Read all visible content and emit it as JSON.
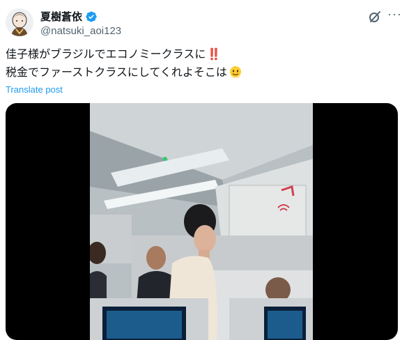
{
  "user": {
    "display_name": "夏樹蒼依",
    "handle": "@natsuki_aoi123",
    "verified": true,
    "verified_color": "#1d9bf0"
  },
  "post": {
    "line1": "佳子様がブラジルでエコノミークラスに",
    "line1_emoji": "‼️",
    "line2": "税金でファーストクラスにしてくれよそこは",
    "line2_emoji": "🫠"
  },
  "translate_label": "Translate post",
  "icons": {
    "grok": "grok-icon",
    "more": "more-icon",
    "verified": "verified-badge-icon"
  },
  "colors": {
    "link": "#1d9bf0",
    "text": "#0f1419",
    "secondary": "#536471"
  }
}
